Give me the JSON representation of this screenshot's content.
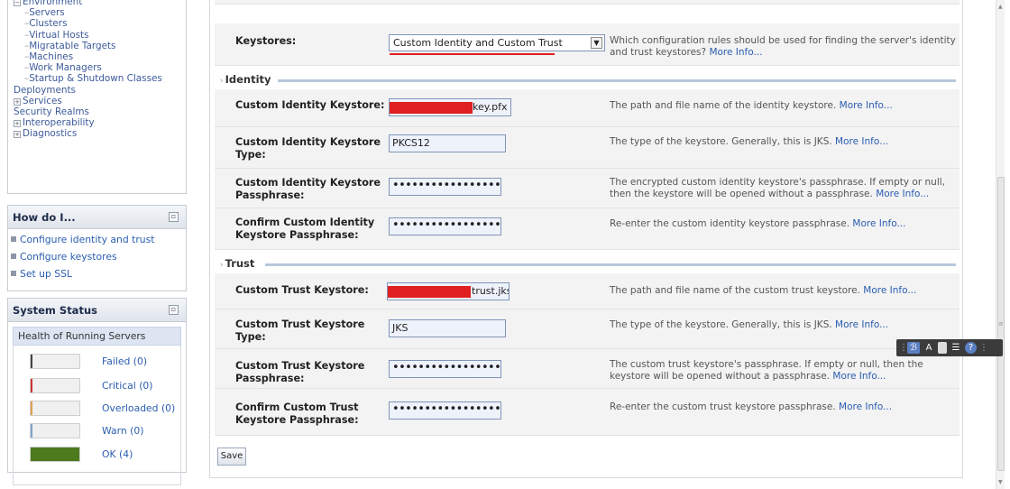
{
  "tree": {
    "items": [
      {
        "label": "Environment",
        "indent": 0,
        "expander": "minus"
      },
      {
        "label": "Servers",
        "indent": 1,
        "expander": ""
      },
      {
        "label": "Clusters",
        "indent": 1,
        "expander": ""
      },
      {
        "label": "Virtual Hosts",
        "indent": 1,
        "expander": ""
      },
      {
        "label": "Migratable Targets",
        "indent": 1,
        "expander": ""
      },
      {
        "label": "Machines",
        "indent": 1,
        "expander": ""
      },
      {
        "label": "Work Managers",
        "indent": 1,
        "expander": ""
      },
      {
        "label": "Startup & Shutdown Classes",
        "indent": 1,
        "expander": ""
      },
      {
        "label": "Deployments",
        "indent": 0,
        "expander": ""
      },
      {
        "label": "Services",
        "indent": 0,
        "expander": "plus"
      },
      {
        "label": "Security Realms",
        "indent": 0,
        "expander": ""
      },
      {
        "label": "Interoperability",
        "indent": 0,
        "expander": "plus"
      },
      {
        "label": "Diagnostics",
        "indent": 0,
        "expander": "plus"
      }
    ]
  },
  "howdoi": {
    "title": "How do I...",
    "links": [
      "Configure identity and trust",
      "Configure keystores",
      "Set up SSL"
    ]
  },
  "system_status": {
    "title": "System Status",
    "health_title": "Health of Running Servers",
    "items": [
      {
        "label": "Failed (0)",
        "color": "#444444",
        "fill": 0
      },
      {
        "label": "Critical (0)",
        "color": "#cc3333",
        "fill": 0
      },
      {
        "label": "Overloaded (0)",
        "color": "#e0a050",
        "fill": 0
      },
      {
        "label": "Warn (0)",
        "color": "#7fa4c8",
        "fill": 0
      },
      {
        "label": "OK (4)",
        "color": "#4e7a1e",
        "fill": 1
      }
    ]
  },
  "form": {
    "keystores": {
      "label": "Keystores:",
      "value": "Custom Identity and Custom Trust",
      "help": "Which configuration rules should be used for finding the server's identity and trust keystores?",
      "more": "More Info..."
    },
    "identity_section": "Identity",
    "custom_identity_keystore": {
      "label": "Custom Identity Keystore:",
      "value": "key.pfx",
      "help": "The path and file name of the identity keystore.",
      "more": "More Info..."
    },
    "custom_identity_keystore_type": {
      "label": "Custom Identity Keystore Type:",
      "value": "PKCS12",
      "help": "The type of the keystore. Generally, this is JKS.",
      "more": "More Info..."
    },
    "custom_identity_passphrase": {
      "label": "Custom Identity Keystore Passphrase:",
      "value": "••••••••••••••••••",
      "help": "The encrypted custom identity keystore's passphrase. If empty or null, then the keystore will be opened without a passphrase.",
      "more": "More Info..."
    },
    "confirm_identity_passphrase": {
      "label": "Confirm Custom Identity Keystore Passphrase:",
      "value": "••••••••••••••••••",
      "help": "Re-enter the custom identity keystore passphrase.",
      "more": "More Info..."
    },
    "trust_section": "Trust",
    "custom_trust_keystore": {
      "label": "Custom Trust Keystore:",
      "value": "trust.jks",
      "help": "The path and file name of the custom trust keystore.",
      "more": "More Info..."
    },
    "custom_trust_keystore_type": {
      "label": "Custom Trust Keystore Type:",
      "value": "JKS",
      "help": "The type of the keystore. Generally, this is JKS.",
      "more": "More Info..."
    },
    "custom_trust_passphrase": {
      "label": "Custom Trust Keystore Passphrase:",
      "value": "••••••••••••••••••",
      "help": "The custom trust keystore's passphrase. If empty or null, then the keystore will be opened without a passphrase.",
      "more": "More Info..."
    },
    "confirm_trust_passphrase": {
      "label": "Confirm Custom Trust Keystore Passphrase:",
      "value": "••••••••••••••••••",
      "help": "Re-enter the custom trust keystore passphrase.",
      "more": "More Info..."
    },
    "save_label": "Save"
  },
  "colors": {
    "redaction": "#e02020",
    "link": "#2a5db0",
    "section_rule": "#b7c7dc"
  }
}
